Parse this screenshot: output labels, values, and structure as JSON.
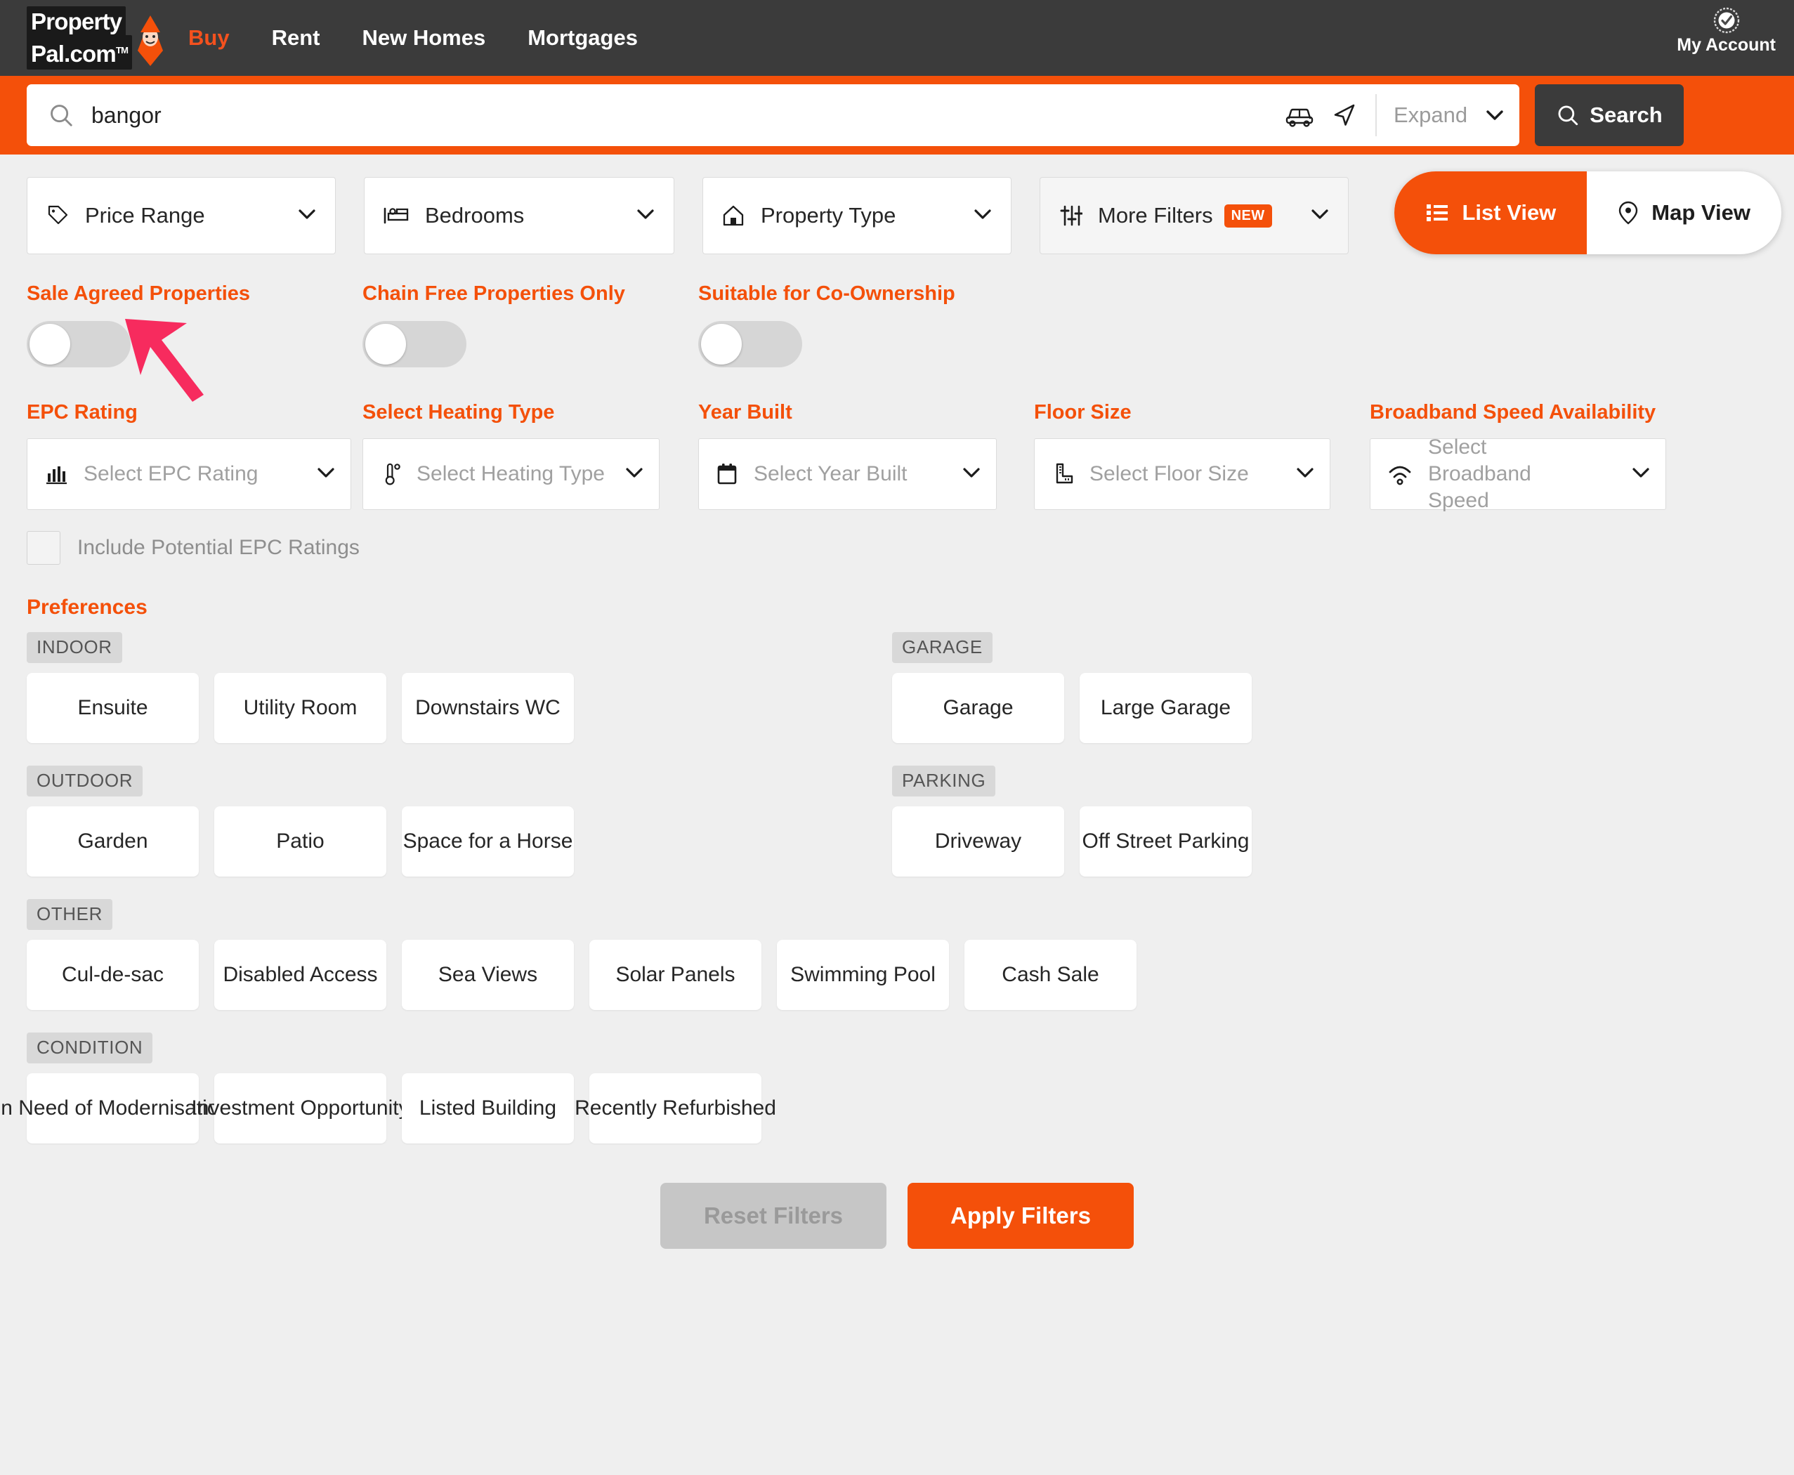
{
  "header": {
    "logo_line1": "Property",
    "logo_line2": "Pal.com",
    "logo_tm": "TM",
    "nav": [
      {
        "label": "Buy",
        "active": true
      },
      {
        "label": "Rent",
        "active": false
      },
      {
        "label": "New Homes",
        "active": false
      },
      {
        "label": "Mortgages",
        "active": false
      }
    ],
    "account_label": "My Account",
    "account_icon": "quality-assurance-badge-icon"
  },
  "search": {
    "icon": "search-icon",
    "value": "bangor",
    "placeholder": "Search",
    "car_icon": "car-commute-icon",
    "locate_icon": "navigate-arrow-icon",
    "expand_placeholder": "Expand",
    "expand_caret": "chevron-down-icon",
    "button_label": "Search",
    "button_icon": "search-icon"
  },
  "filter_bar": {
    "dropdowns": [
      {
        "label": "Price Range",
        "icon": "price-tag-icon"
      },
      {
        "label": "Bedrooms",
        "icon": "bed-icon"
      },
      {
        "label": "Property Type",
        "icon": "house-icon"
      },
      {
        "label": "More Filters",
        "icon": "sliders-icon",
        "badge": "NEW"
      }
    ],
    "view_toggle": [
      {
        "label": "List View",
        "icon": "list-icon",
        "active": true
      },
      {
        "label": "Map View",
        "icon": "map-pin-icon",
        "active": false
      }
    ]
  },
  "toggles": [
    {
      "label": "Sale Agreed Properties",
      "on": false
    },
    {
      "label": "Chain Free Properties Only",
      "on": false
    },
    {
      "label": "Suitable for Co-Ownership",
      "on": false
    }
  ],
  "annotation": {
    "type": "arrow",
    "color": "#f72b5e",
    "points_to": "Sale Agreed Properties toggle"
  },
  "selects": [
    {
      "title": "EPC Rating",
      "placeholder": "Select EPC Rating",
      "icon": "bar-chart-icon"
    },
    {
      "title": "Select Heating Type",
      "placeholder": "Select Heating Type",
      "icon": "thermometer-icon"
    },
    {
      "title": "Year Built",
      "placeholder": "Select Year Built",
      "icon": "calendar-icon"
    },
    {
      "title": "Floor Size",
      "placeholder": "Select Floor Size",
      "icon": "ruler-icon"
    },
    {
      "title": "Broadband Speed Availability",
      "placeholder": "Select Broadband Speed",
      "icon": "wifi-icon"
    }
  ],
  "checkbox": {
    "label": "Include Potential EPC Ratings",
    "checked": false
  },
  "preferences": {
    "title": "Preferences",
    "groups": [
      {
        "category": "INDOOR",
        "column": "left",
        "items": [
          "Ensuite",
          "Utility Room",
          "Downstairs WC"
        ]
      },
      {
        "category": "GARAGE",
        "column": "right",
        "items": [
          "Garage",
          "Large Garage"
        ]
      },
      {
        "category": "OUTDOOR",
        "column": "left",
        "items": [
          "Garden",
          "Patio",
          "Space for a Horse"
        ]
      },
      {
        "category": "PARKING",
        "column": "right",
        "items": [
          "Driveway",
          "Off Street Parking"
        ]
      },
      {
        "category": "OTHER",
        "column": "full",
        "items": [
          "Cul-de-sac",
          "Disabled Access",
          "Sea Views",
          "Solar Panels",
          "Swimming Pool",
          "Cash Sale"
        ]
      },
      {
        "category": "CONDITION",
        "column": "full",
        "items": [
          "In Need of Modernisation",
          "Investment Opportunity",
          "Listed Building",
          "Recently Refurbished"
        ]
      }
    ]
  },
  "footer": {
    "reset_label": "Reset Filters",
    "apply_label": "Apply Filters"
  },
  "colors": {
    "brand_orange": "#f4500a",
    "nav_dark": "#3b3b3b",
    "page_bg": "#efefef",
    "annotation_pink": "#f72b5e"
  }
}
